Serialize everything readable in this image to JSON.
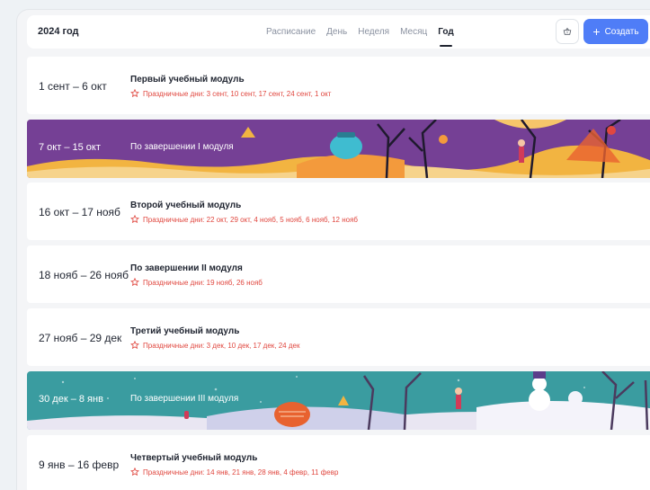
{
  "header": {
    "year": "2024 год",
    "tabs": [
      "Расписание",
      "День",
      "Неделя",
      "Месяц",
      "Год"
    ],
    "active_tab": "Год",
    "create_label": "Создать"
  },
  "rows": [
    {
      "range": "1 сент – 6 окт",
      "title": "Первый учебный модуль",
      "holidays": "Праздничные дни: 3 сент, 10 сент, 17 сент, 24 сент, 1 окт"
    },
    {
      "range": "7 окт – 15 окт",
      "title": "По завершении I модуля",
      "banner": "autumn"
    },
    {
      "range": "16 окт – 17 нояб",
      "title": "Второй учебный модуль",
      "holidays": "Праздничные дни: 22 окт, 29 окт, 4 нояб, 5 нояб, 6 нояб, 12 нояб"
    },
    {
      "range": "18 нояб – 26 нояб",
      "title": "По завершении II модуля",
      "holidays": "Праздничные дни: 19 нояб, 26 нояб"
    },
    {
      "range": "27 нояб – 29 дек",
      "title": "Третий учебный модуль",
      "holidays": "Праздничные дни: 3 дек, 10 дек, 17 дек, 24 дек"
    },
    {
      "range": "30 дек – 8 янв",
      "title": "По завершении III модуля",
      "banner": "winter"
    },
    {
      "range": "9 янв – 16 февр",
      "title": "Четвертый учебный модуль",
      "holidays": "Праздничные дни: 14 янв, 21 янв, 28 янв, 4 февр, 11 февр"
    }
  ],
  "colors": {
    "accent": "#4f7df7",
    "holiday_red": "#e0473f",
    "autumn_bg": "#6f3d8f",
    "winter_bg": "#3a9ca0"
  },
  "icons": {
    "settings": "basket-icon",
    "plus": "plus-icon",
    "holiday": "star-icon"
  }
}
